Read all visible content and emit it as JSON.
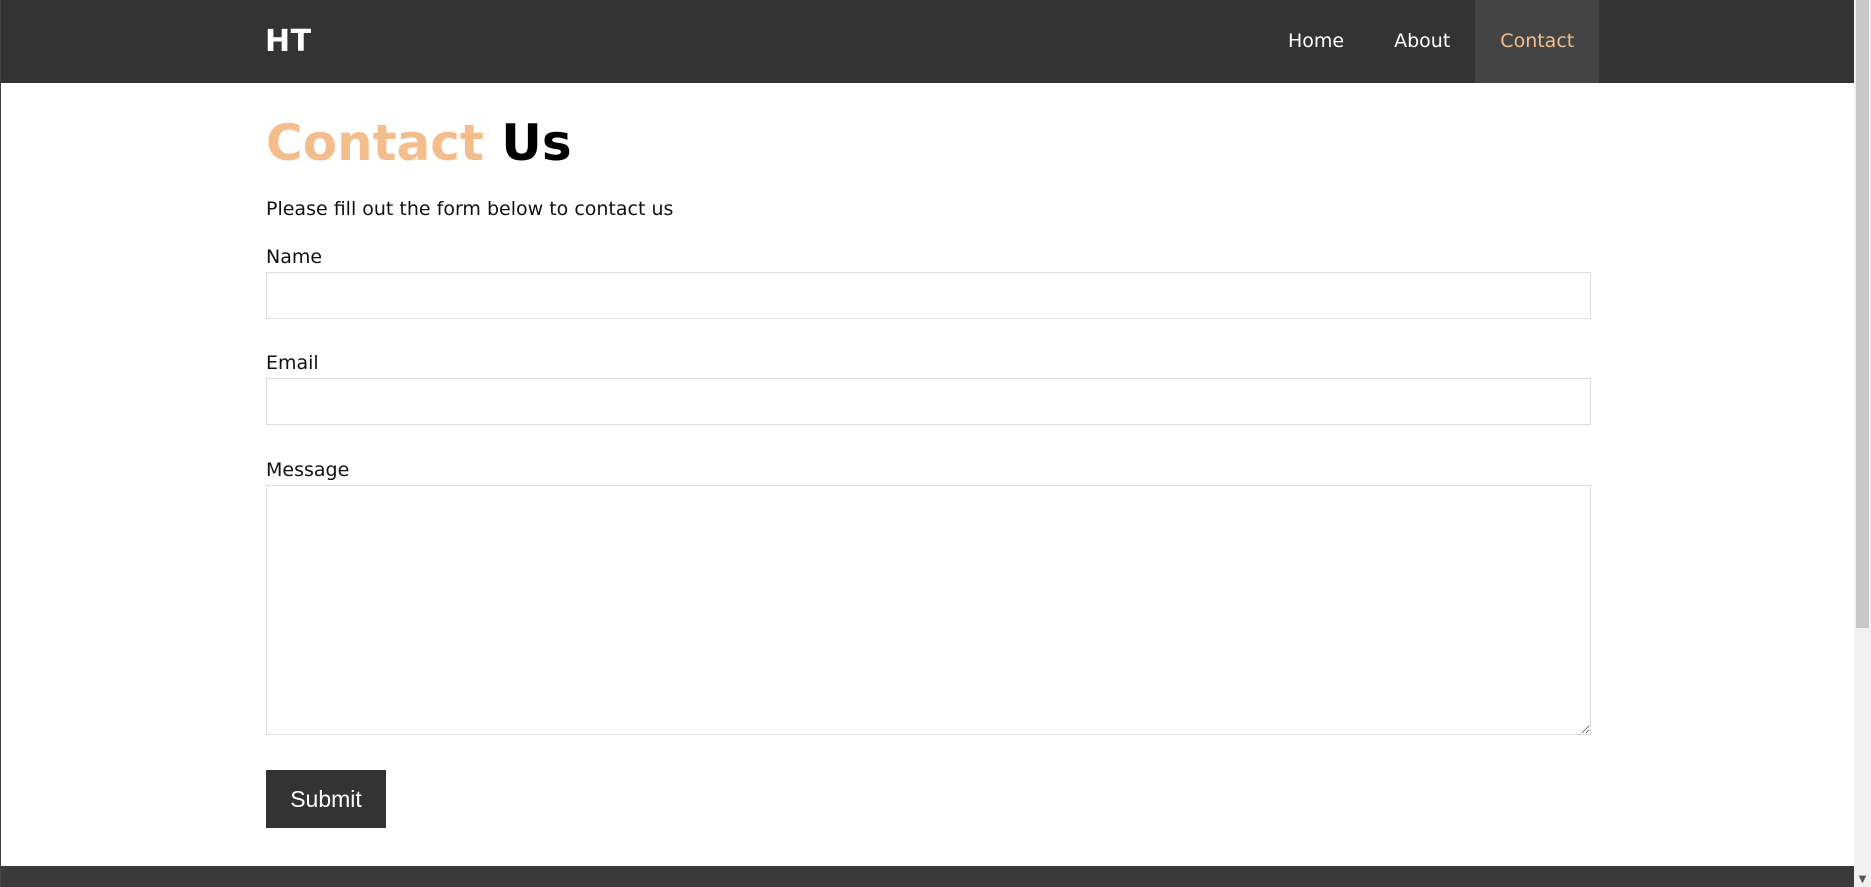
{
  "nav": {
    "brand": "HT",
    "links": [
      {
        "label": "Home"
      },
      {
        "label": "About"
      },
      {
        "label": "Contact"
      }
    ],
    "active_index": 2
  },
  "page": {
    "title_accent": "Contact",
    "title_rest": "Us",
    "intro": "Please fill out the form below to contact us"
  },
  "form": {
    "name_label": "Name",
    "name_value": "",
    "email_label": "Email",
    "email_value": "",
    "message_label": "Message",
    "message_value": "",
    "submit_label": "Submit"
  },
  "colors": {
    "accent": "#f4be8c",
    "navbar": "#333333",
    "active_nav": "#444444",
    "button": "#333333"
  },
  "icons": {
    "scroll_down": "chevron-down-icon",
    "resize": "resize-handle-icon"
  }
}
